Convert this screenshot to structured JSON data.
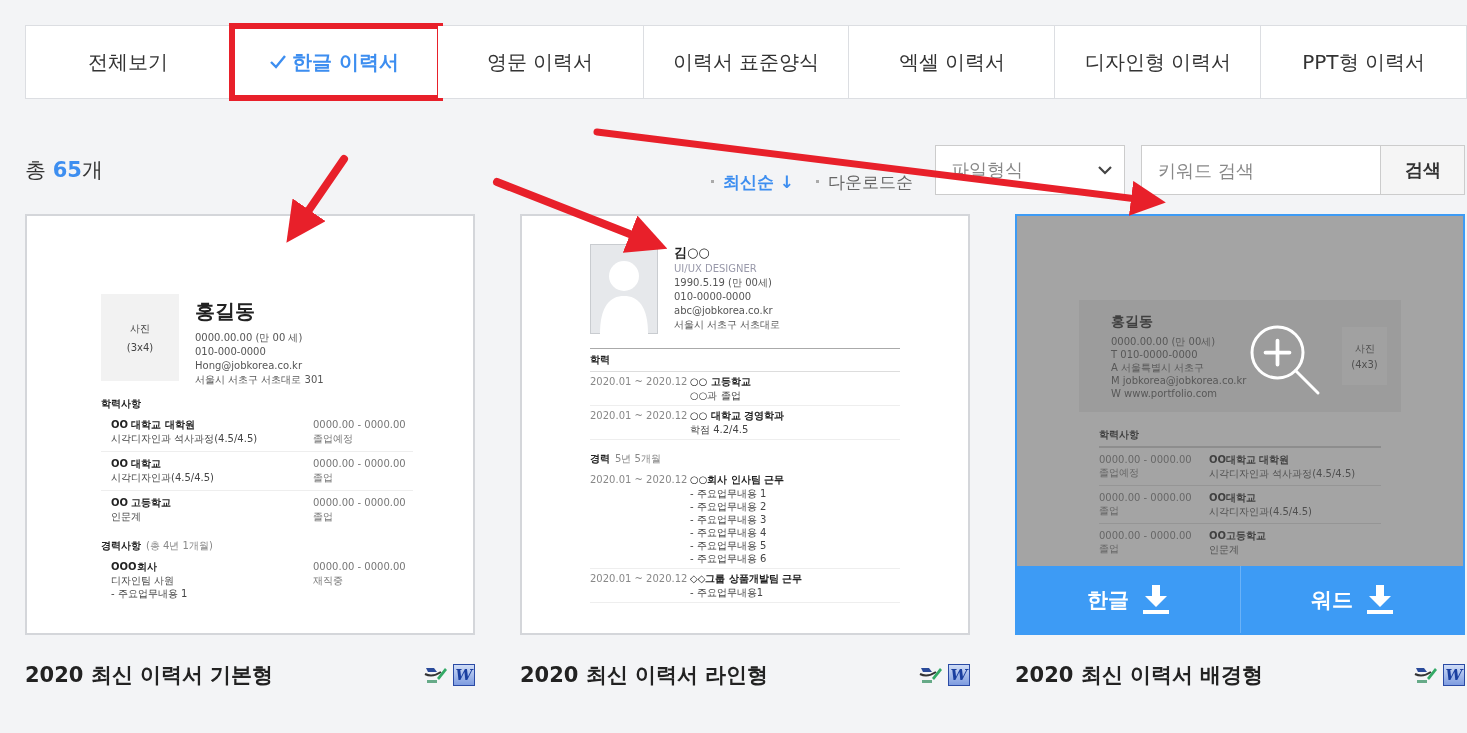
{
  "tabs": [
    {
      "label": "전체보기",
      "selected": false,
      "highlighted": false
    },
    {
      "label": "한글 이력서",
      "selected": true,
      "highlighted": true
    },
    {
      "label": "영문 이력서",
      "selected": false,
      "highlighted": false
    },
    {
      "label": "이력서 표준양식",
      "selected": false,
      "highlighted": false
    },
    {
      "label": "엑셀 이력서",
      "selected": false,
      "highlighted": false
    },
    {
      "label": "디자인형 이력서",
      "selected": false,
      "highlighted": false
    },
    {
      "label": "PPT형 이력서",
      "selected": false,
      "highlighted": false
    }
  ],
  "toolbar": {
    "total_prefix": "총",
    "total_count": "65",
    "total_suffix": "개",
    "sort": [
      {
        "label": "최신순 ↓",
        "selected": true
      },
      {
        "label": "다운로드순",
        "selected": false
      }
    ],
    "format_select": {
      "placeholder": "파일형식"
    },
    "search": {
      "placeholder": "키워드 검색",
      "button": "검색"
    }
  },
  "cards": [
    {
      "title": "2020 최신 이력서 기본형",
      "hovered": false,
      "kind": "basic",
      "preview": {
        "name": "홍길동",
        "photo": [
          "사진",
          "(3x4)"
        ],
        "info": [
          "0000.00.00 (만 00 세)",
          "010-000-0000",
          "Hong@jobkorea.co.kr",
          "서울시  서초구  서초대로 301"
        ],
        "sections": [
          {
            "heading": "학력사항",
            "rows": [
              {
                "date": "0000.00 - 0000.00",
                "status": "졸업예정",
                "title": "OO 대학교  대학원",
                "lines": [
                  "시각디자인과  석사과정(4.5/4.5)"
                ]
              },
              {
                "date": "0000.00 - 0000.00",
                "status": "졸업",
                "title": "OO 대학교",
                "lines": [
                  "시각디자인과(4.5/4.5)"
                ]
              },
              {
                "date": "0000.00 - 0000.00",
                "status": "졸업",
                "title": "OO 고등학교",
                "lines": [
                  "인문계"
                ]
              }
            ]
          },
          {
            "heading": "경력사항",
            "note": "(총 4년 1개월)",
            "rows": [
              {
                "date": "0000.00 - 0000.00",
                "status": "재직중",
                "title": "OOO회사",
                "lines": [
                  "디자인팀 사원",
                  "- 주요업무내용 1"
                ]
              }
            ]
          }
        ]
      },
      "files": [
        {
          "kind": "hwp"
        },
        {
          "kind": "word",
          "glyph": "W"
        }
      ]
    },
    {
      "title": "2020 최신 이력서 라인형",
      "hovered": false,
      "kind": "line",
      "preview": {
        "name": "김○○",
        "role": "UI/UX DESIGNER",
        "info": [
          "1990.5.19 (만 00세)",
          "010-0000-0000",
          "abc@jobkorea.co.kr",
          "서울시  서초구  서초대로"
        ],
        "sections": [
          {
            "heading": "학력",
            "rows": [
              {
                "date": "2020.01 ~ 2020.12",
                "title": "○○ 고등학교",
                "lines": [
                  "○○과 졸업"
                ]
              },
              {
                "date": "2020.01 ~ 2020.12",
                "title": "○○ 대학교 경영학과",
                "lines": [
                  "학점 4.2/4.5"
                ]
              }
            ]
          },
          {
            "heading": "경력",
            "note": "5년 5개월",
            "rows": [
              {
                "date": "2020.01 ~ 2020.12",
                "title": "○○회사 인사팀 근무",
                "lines": [
                  "- 주요업무내용 1",
                  "- 주요업무내용 2",
                  "- 주요업무내용 3",
                  "- 주요업무내용 4",
                  "- 주요업무내용 5",
                  "- 주요업무내용 6"
                ]
              },
              {
                "date": "2020.01 ~ 2020.12",
                "title": "◇◇그룹 상품개발팀 근무",
                "lines": [
                  "- 주요업무내용1"
                ]
              }
            ]
          }
        ]
      },
      "files": [
        {
          "kind": "hwp"
        },
        {
          "kind": "word",
          "glyph": "W"
        }
      ]
    },
    {
      "title": "2020 최신 이력서 배경형",
      "hovered": true,
      "kind": "banner",
      "preview": {
        "name": "홍길동",
        "photo": [
          "사진",
          "(4x3)"
        ],
        "info": [
          "0000.00.00 (만 00세)",
          "T 010-0000-0000",
          "A 서울특별시 서초구",
          "M jobkorea@jobkorea.co.kr",
          "W www.portfolio.com"
        ],
        "sections": [
          {
            "heading": "학력사항",
            "rows": [
              {
                "date": "0000.00 - 0000.00",
                "status": "졸업예정",
                "title": "OO대학교 대학원",
                "lines": [
                  "시각디자인과 석사과정(4.5/4.5)"
                ]
              },
              {
                "date": "0000.00 - 0000.00",
                "status": "졸업",
                "title": "OO대학교",
                "lines": [
                  "시각디자인과(4.5/4.5)"
                ]
              },
              {
                "date": "0000.00 - 0000.00",
                "status": "졸업",
                "title": "OO고등학교",
                "lines": [
                  "인문계"
                ]
              }
            ]
          }
        ]
      },
      "downloads": [
        "한글",
        "워드"
      ],
      "files": [
        {
          "kind": "hwp"
        },
        {
          "kind": "word",
          "glyph": "W"
        }
      ]
    }
  ]
}
